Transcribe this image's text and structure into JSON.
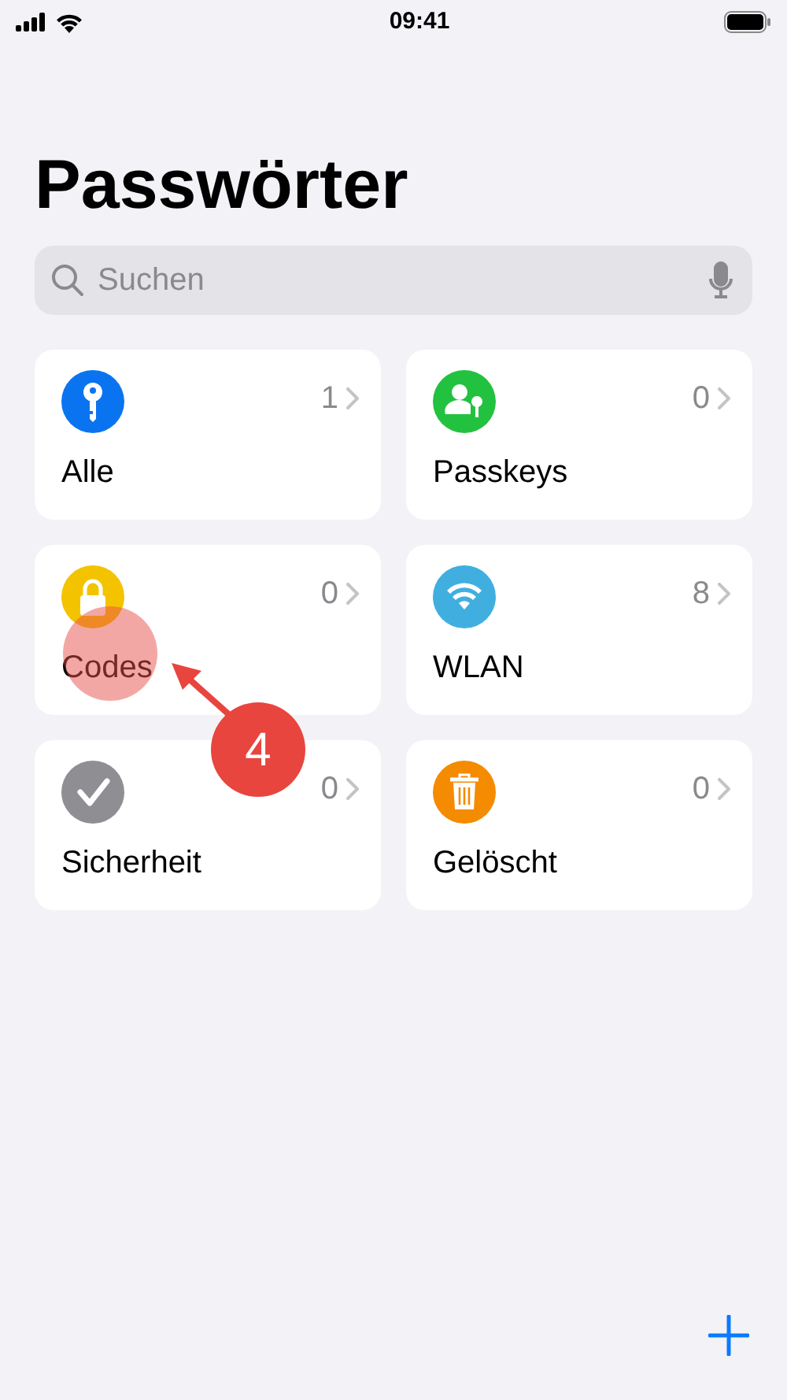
{
  "status_bar": {
    "time": "09:41"
  },
  "title": "Passwörter",
  "search": {
    "placeholder": "Suchen"
  },
  "categories": [
    {
      "kind": "key",
      "label": "Alle",
      "count": "1",
      "color": "#0a74f0"
    },
    {
      "kind": "passkey",
      "label": "Passkeys",
      "count": "0",
      "color": "#23c140"
    },
    {
      "kind": "lock",
      "label": "Codes",
      "count": "0",
      "color": "#f4c300"
    },
    {
      "kind": "wifi",
      "label": "WLAN",
      "count": "8",
      "color": "#40afe0"
    },
    {
      "kind": "check",
      "label": "Sicherheit",
      "count": "0",
      "color": "#8e8e93"
    },
    {
      "kind": "trash",
      "label": "Gelöscht",
      "count": "0",
      "color": "#f58b00"
    }
  ],
  "tutorial": {
    "step": "4"
  }
}
